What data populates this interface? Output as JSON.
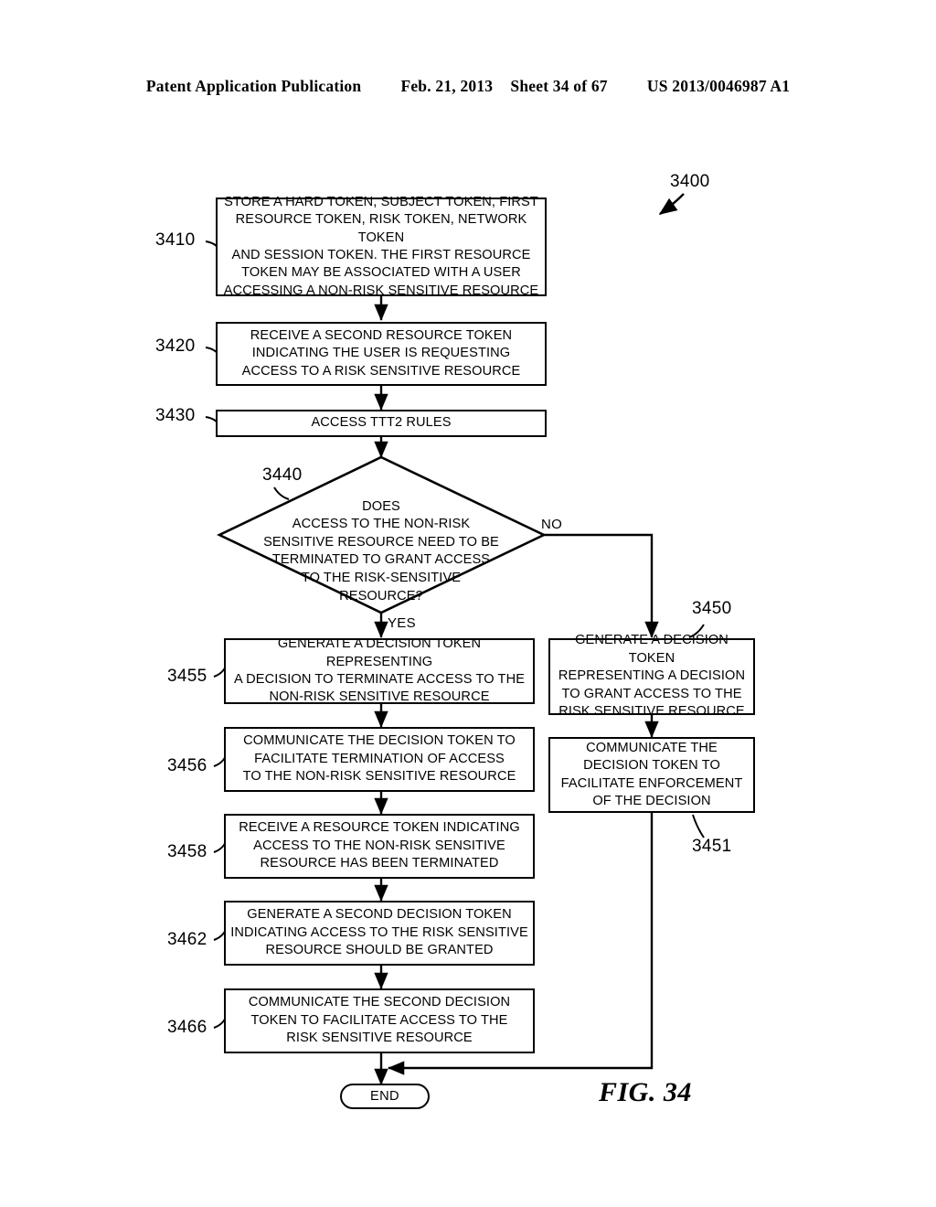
{
  "header": {
    "publication": "Patent Application Publication",
    "date": "Feb. 21, 2013",
    "sheet": "Sheet 34 of 67",
    "patent_number": "US 2013/0046987 A1"
  },
  "figure": {
    "caption": "FIG. 34",
    "diagram_ref": "3400"
  },
  "nodes": {
    "n3410": {
      "ref": "3410",
      "text": "STORE A HARD TOKEN, SUBJECT TOKEN, FIRST\nRESOURCE TOKEN, RISK TOKEN, NETWORK TOKEN\nAND SESSION TOKEN. THE FIRST RESOURCE\nTOKEN MAY BE ASSOCIATED WITH A USER\nACCESSING A NON-RISK SENSITIVE RESOURCE"
    },
    "n3420": {
      "ref": "3420",
      "text": "RECEIVE A SECOND RESOURCE TOKEN\nINDICATING THE USER IS REQUESTING\nACCESS TO A RISK SENSITIVE RESOURCE"
    },
    "n3430": {
      "ref": "3430",
      "text": "ACCESS TTT2 RULES"
    },
    "n3440": {
      "ref": "3440",
      "text": "DOES\nACCESS TO THE NON-RISK\nSENSITIVE RESOURCE NEED TO BE\nTERMINATED TO GRANT ACCESS\nTO THE RISK-SENSITIVE\nRESOURCE?",
      "yes_label": "YES",
      "no_label": "NO"
    },
    "n3455": {
      "ref": "3455",
      "text": "GENERATE A DECISION TOKEN REPRESENTING\nA DECISION TO TERMINATE ACCESS TO THE\nNON-RISK SENSITIVE RESOURCE"
    },
    "n3456": {
      "ref": "3456",
      "text": "COMMUNICATE THE DECISION TOKEN TO\nFACILITATE TERMINATION OF ACCESS\nTO THE NON-RISK SENSITIVE RESOURCE"
    },
    "n3458": {
      "ref": "3458",
      "text": "RECEIVE A RESOURCE TOKEN INDICATING\nACCESS TO THE NON-RISK SENSITIVE\nRESOURCE HAS BEEN TERMINATED"
    },
    "n3462": {
      "ref": "3462",
      "text": "GENERATE A SECOND DECISION TOKEN\nINDICATING ACCESS TO THE RISK SENSITIVE\nRESOURCE SHOULD BE GRANTED"
    },
    "n3466": {
      "ref": "3466",
      "text": "COMMUNICATE THE SECOND DECISION\nTOKEN TO FACILITATE ACCESS TO THE\nRISK SENSITIVE RESOURCE"
    },
    "n3450": {
      "ref": "3450",
      "text": "GENERATE A DECISION TOKEN\nREPRESENTING A DECISION\nTO GRANT ACCESS TO THE\nRISK SENSITIVE RESOURCE"
    },
    "n3451": {
      "ref": "3451",
      "text": "COMMUNICATE THE\nDECISION TOKEN TO\nFACILITATE ENFORCEMENT\nOF THE DECISION"
    },
    "end": {
      "text": "END"
    }
  },
  "colors": {
    "ink": "#000000",
    "paper": "#ffffff"
  }
}
